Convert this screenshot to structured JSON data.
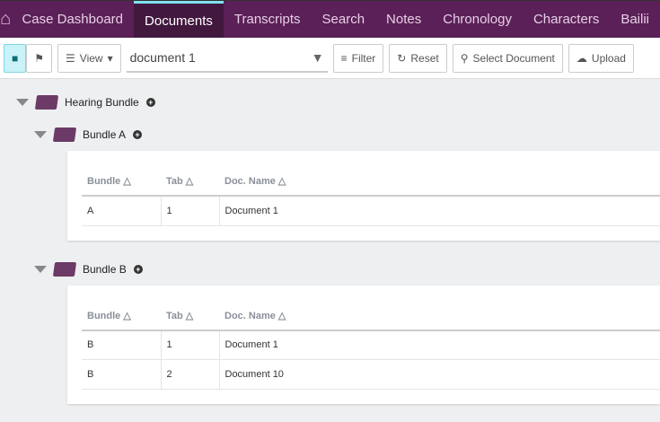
{
  "nav": {
    "items": [
      "Case Dashboard",
      "Documents",
      "Transcripts",
      "Search",
      "Notes",
      "Chronology",
      "Characters",
      "Bailii"
    ],
    "active": "Documents"
  },
  "toolbar": {
    "view": "View",
    "search_value": "document 1",
    "filter": "Filter",
    "reset": "Reset",
    "select_document": "Select Document",
    "upload": "Upload"
  },
  "tree": {
    "root": "Hearing Bundle",
    "columns": [
      "Bundle",
      "Tab",
      "Doc. Name"
    ],
    "bundles": [
      {
        "name": "Bundle A",
        "rows": [
          [
            "A",
            "1",
            "Document 1"
          ]
        ]
      },
      {
        "name": "Bundle B",
        "rows": [
          [
            "B",
            "1",
            "Document 1"
          ],
          [
            "B",
            "2",
            "Document 10"
          ]
        ]
      }
    ]
  }
}
